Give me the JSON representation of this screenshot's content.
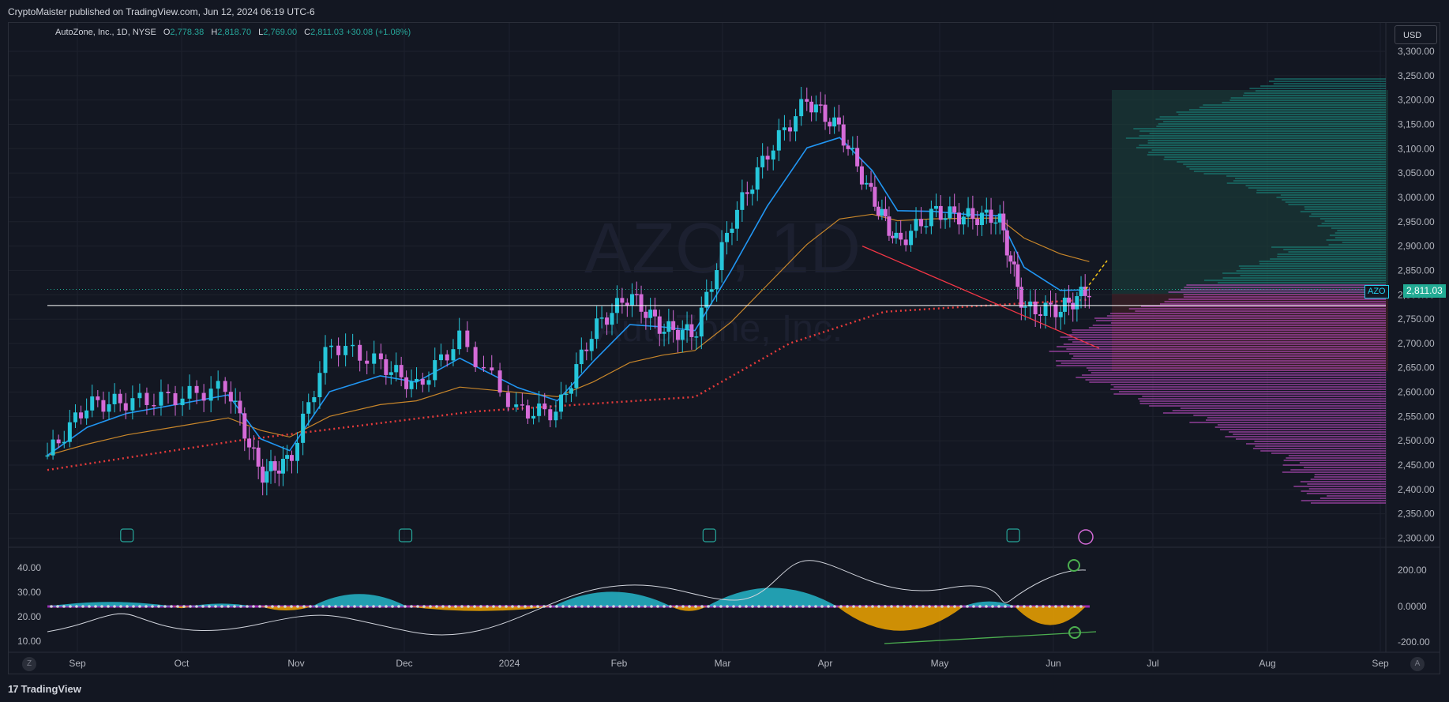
{
  "header": {
    "published": "CryptoMaister published on TradingView.com, Jun 12, 2024 06:19 UTC-6"
  },
  "legend": {
    "symbol": "AutoZone, Inc., 1D, NYSE",
    "o_label": "O",
    "o_value": "2,778.38",
    "h_label": "H",
    "h_value": "2,818.70",
    "l_label": "L",
    "l_value": "2,769.00",
    "c_label": "C",
    "c_value": "2,811.03",
    "change": "+30.08 (+1.08%)"
  },
  "currency": "USD",
  "price_tag": {
    "symbol": "AZO",
    "value": "2,811.03"
  },
  "watermark": {
    "ticker": "AZO, 1D",
    "name": "AutoZone, Inc."
  },
  "footer": {
    "brand": "TradingView",
    "left_btn": "Z",
    "right_btn": "A"
  },
  "colors": {
    "up": "#26c6da",
    "down": "#d56bd8",
    "ema_fast": "#2196f3",
    "ema_slow": "#c8862a",
    "sma_long": "#e53a3a",
    "trend": "#f23645",
    "vp_up": "#1b8a80",
    "vp_down": "#c44fc8",
    "osc_up": "#26b6c9",
    "osc_down": "#f0a500",
    "divergence": "#4caf50"
  },
  "chart_data": [
    {
      "type": "line",
      "title": "",
      "ylim": [
        2280,
        3330
      ],
      "y_ticks": [
        "3,300.00",
        "3,250.00",
        "3,200.00",
        "3,150.00",
        "3,100.00",
        "3,050.00",
        "3,000.00",
        "2,950.00",
        "2,900.00",
        "2,850.00",
        "2,800.00",
        "2,750.00",
        "2,700.00",
        "2,650.00",
        "2,600.00",
        "2,550.00",
        "2,500.00",
        "2,450.00",
        "2,400.00",
        "2,350.00",
        "2,300.00"
      ],
      "x_ticks": [
        "Sep",
        "Oct",
        "Nov",
        "Dec",
        "2024",
        "Feb",
        "Mar",
        "Apr",
        "May",
        "Jun",
        "Jul",
        "Aug",
        "Sep"
      ],
      "x_range": [
        "2023-08-28",
        "2024-09-01"
      ],
      "horizontal_level": 2778,
      "earnings_marks": [
        "2023-09-19",
        "2023-12-05",
        "2024-02-27",
        "2024-05-21"
      ],
      "series": [
        {
          "values_x": [
            "2023-08-28",
            "2023-09-08",
            "2023-09-19",
            "2023-10-03",
            "2023-10-17",
            "2023-10-26",
            "2023-11-03",
            "2023-11-14",
            "2023-11-28",
            "2023-12-08",
            "2023-12-20",
            "2024-01-05",
            "2024-01-16",
            "2024-01-26",
            "2024-02-05",
            "2024-02-14",
            "2024-02-23",
            "2024-03-04",
            "2024-03-14",
            "2024-03-25",
            "2024-04-03",
            "2024-04-12",
            "2024-04-19",
            "2024-04-29",
            "2024-05-08",
            "2024-05-17",
            "2024-05-24",
            "2024-06-03",
            "2024-06-11"
          ],
          "values": [
            2470,
            2575,
            2580,
            2590,
            2610,
            2430,
            2460,
            2700,
            2660,
            2610,
            2710,
            2560,
            2560,
            2730,
            2800,
            2730,
            2720,
            2950,
            3090,
            3200,
            3140,
            3000,
            2905,
            2970,
            2960,
            2960,
            2770,
            2770,
            2811
          ]
        }
      ]
    },
    {
      "type": "area",
      "title": "",
      "left_ticks": [
        "40.00",
        "30.00",
        "20.00",
        "10.00"
      ],
      "right_ticks": [
        "200.00",
        "0.0000",
        "-200.00"
      ],
      "ylim": [
        -230,
        230
      ]
    }
  ]
}
